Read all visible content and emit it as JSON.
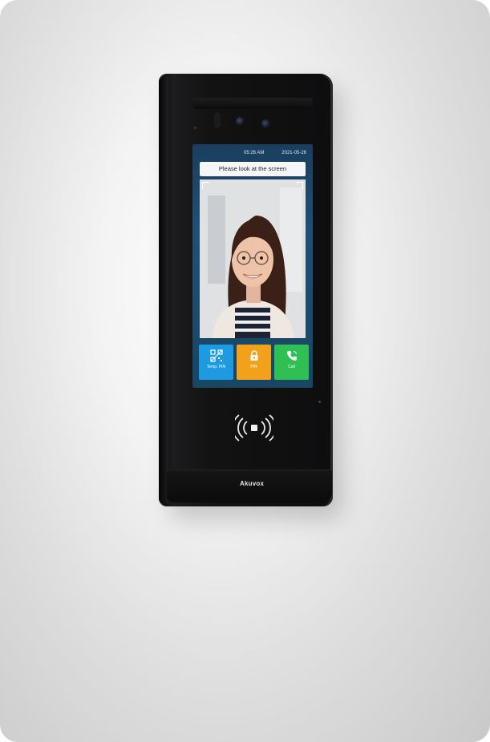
{
  "device": {
    "screen": {
      "status": {
        "time": "05:26 AM",
        "date": "2021-05-26"
      },
      "prompt": "Please look at the screen",
      "actions": [
        {
          "label": "Temp. PIN",
          "icon": "qr-code-icon",
          "color": "#1e9be0"
        },
        {
          "label": "PIN",
          "icon": "lock-icon",
          "color": "#f2a21a"
        },
        {
          "label": "Call",
          "icon": "phone-icon",
          "color": "#2fbf54"
        }
      ]
    },
    "brand": "Akuvox",
    "nfc_icon": "nfc-reader-icon"
  }
}
